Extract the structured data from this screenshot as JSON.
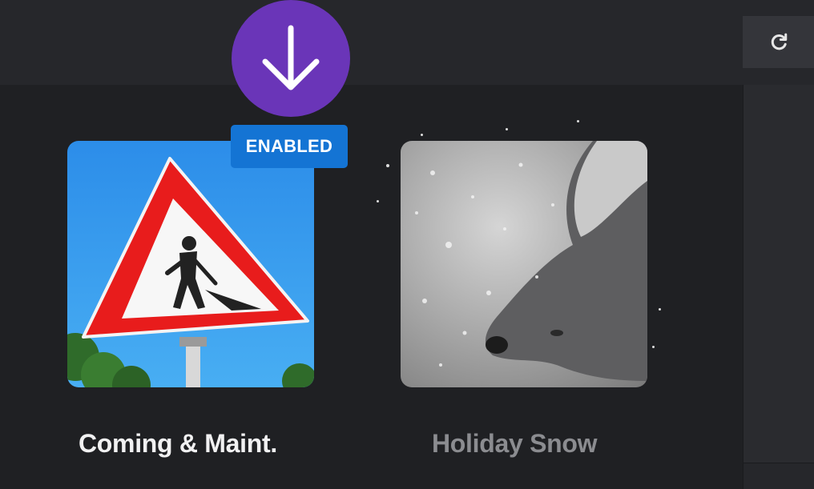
{
  "toolbar": {
    "refresh_icon": "refresh-icon"
  },
  "download": {
    "icon": "arrow-down-icon"
  },
  "badge": {
    "label": "ENABLED"
  },
  "cards": [
    {
      "title": "Coming & Maint.",
      "image": "road-work-sign",
      "state": "enabled"
    },
    {
      "title": "Holiday Snow",
      "image": "wolf-in-snow",
      "state": "disabled"
    }
  ],
  "colors": {
    "accent_purple": "#6a35b8",
    "badge_blue": "#1474d4",
    "background": "#1f2023"
  }
}
